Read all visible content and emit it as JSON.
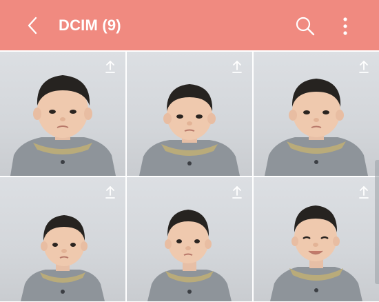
{
  "appbar": {
    "title": "DCIM (9)",
    "background_color": "#f08a80",
    "icons": [
      "back-arrow-icon",
      "search-icon",
      "more-vertical-icon"
    ]
  },
  "photos": [
    {
      "icon": "upload-icon"
    },
    {
      "icon": "upload-icon"
    },
    {
      "icon": "upload-icon"
    },
    {
      "icon": "upload-icon"
    },
    {
      "icon": "upload-icon"
    },
    {
      "icon": "upload-icon"
    }
  ]
}
